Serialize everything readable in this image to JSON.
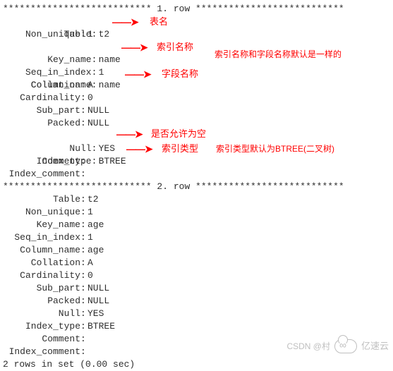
{
  "header1": "*************************** 1. row ***************************",
  "header2": "*************************** 2. row ***************************",
  "labels": {
    "table": "Table",
    "non_unique": "Non_unique",
    "key_name": "Key_name",
    "seq_in_index": "Seq_in_index",
    "column_name": "Column_name",
    "collation": "Collation",
    "cardinality": "Cardinality",
    "sub_part": "Sub_part",
    "packed": "Packed",
    "null": "Null",
    "index_type": "Index_type",
    "comment": "Comment",
    "index_comment": "Index_comment"
  },
  "row1": {
    "table": "t2",
    "non_unique": "1",
    "key_name": "name",
    "seq_in_index": "1",
    "column_name": "name",
    "collation": "A",
    "cardinality": "0",
    "sub_part": "NULL",
    "packed": "NULL",
    "null": "YES",
    "index_type": "BTREE",
    "comment": "",
    "index_comment": ""
  },
  "row2": {
    "table": "t2",
    "non_unique": "1",
    "key_name": "age",
    "seq_in_index": "1",
    "column_name": "age",
    "collation": "A",
    "cardinality": "0",
    "sub_part": "NULL",
    "packed": "NULL",
    "null": "YES",
    "index_type": "BTREE",
    "comment": "",
    "index_comment": ""
  },
  "footer": "2 rows in set (0.00 sec)",
  "annotations": {
    "table_name": "表名",
    "index_name": "索引名称",
    "index_field_note": "索引名称和字段名称默认是一样的",
    "column_name": "字段名称",
    "allow_null": "是否允许为空",
    "index_type": "索引类型",
    "index_type_note": "索引类型默认为BTREE(二叉树)"
  },
  "arrow": "——➤",
  "watermark": {
    "csdn": "CSDN @村",
    "brand": "亿速云"
  }
}
